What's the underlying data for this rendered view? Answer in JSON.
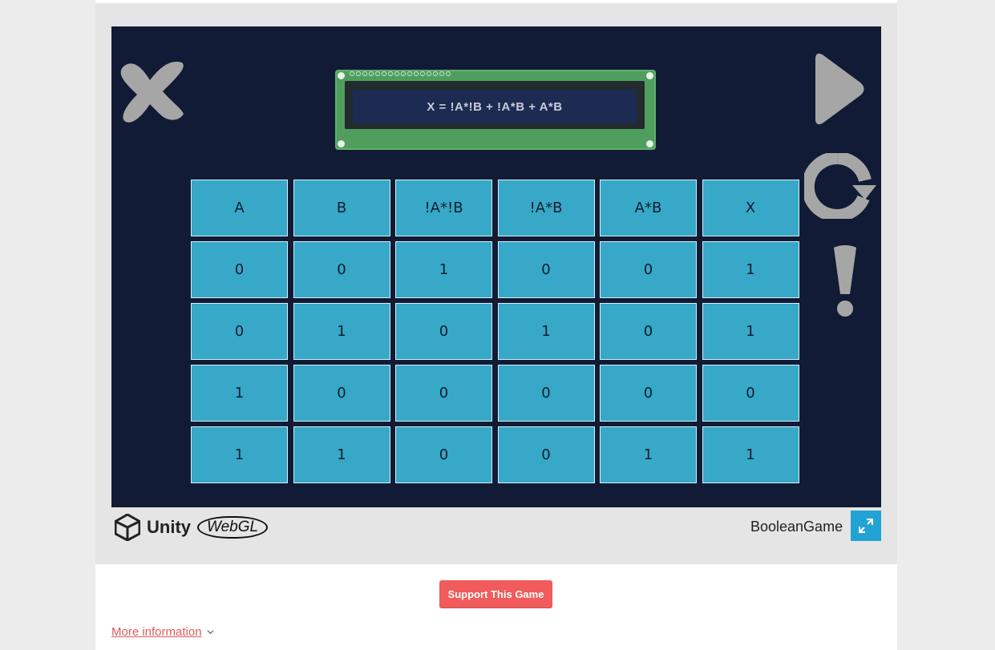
{
  "game": {
    "expression": "X = !A*!B + !A*B + A*B",
    "title": "BooleanGame"
  },
  "table": {
    "headers": [
      "A",
      "B",
      "!A*!B",
      "!A*B",
      "A*B",
      "X"
    ],
    "rows": [
      [
        "0",
        "0",
        "1",
        "0",
        "0",
        "1"
      ],
      [
        "0",
        "1",
        "0",
        "1",
        "0",
        "1"
      ],
      [
        "1",
        "0",
        "0",
        "0",
        "0",
        "0"
      ],
      [
        "1",
        "1",
        "0",
        "0",
        "1",
        "1"
      ]
    ]
  },
  "engine": {
    "unity_label": "Unity",
    "webgl_label": "WebGL"
  },
  "actions": {
    "support_label": "Support This Game",
    "more_info_label": "More information"
  },
  "icons": [
    "close-icon",
    "play-icon",
    "restart-icon",
    "hint-icon",
    "fullscreen-icon",
    "chevron-down-icon"
  ],
  "colors": {
    "canvas_bg": "#121b35",
    "cell": "#37a8c8",
    "support": "#f15b5b",
    "fullscreen": "#21a3d4",
    "link": "#e25a5a"
  }
}
